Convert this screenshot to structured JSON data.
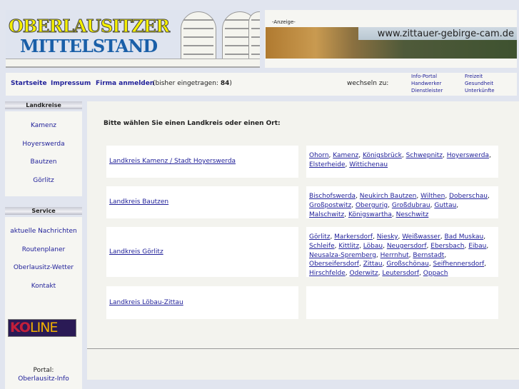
{
  "header": {
    "logo_line1": "OBERLAUSITZER",
    "logo_line2": "MITTELSTAND",
    "ad_label": "-Anzeige-",
    "ad_text": "www.zittauer-gebirge-cam.de"
  },
  "nav": {
    "items": [
      "Startseite",
      "Impressum",
      "Firma anmelden"
    ],
    "count_prefix": "(bisher eingetragen: ",
    "count": "84",
    "count_suffix": ")",
    "switch_label": "wechseln zu:",
    "switch_links": [
      "Info-Portal",
      "Handwerker",
      "Dienstleister",
      "Freizeit",
      "Gesundheit",
      "Unterkünfte"
    ]
  },
  "sidebar": {
    "landkreise_title": "Landkreise",
    "landkreise": [
      "Kamenz",
      "Hoyerswerda",
      "Bautzen",
      "Görlitz"
    ],
    "service_title": "Service",
    "service": [
      "aktuelle Nachrichten",
      "Routenplaner",
      "Oberlausitz-Wetter",
      "Kontakt"
    ],
    "banner_logo": "KOLINE",
    "portal_label": "Portal:",
    "portal_link": "Oberlausitz-Info"
  },
  "main": {
    "intro": "Bitte wählen Sie einen Landkreis oder einen Ort:",
    "rows": [
      {
        "district": "Landkreis Kamenz / Stadt Hoyerswerda",
        "places": [
          "Ohorn",
          "Kamenz",
          "Königsbrück",
          "Schwepnitz",
          "Hoyerswerda",
          "Elsterheide",
          "Wittichenau"
        ]
      },
      {
        "district": "Landkreis Bautzen",
        "places": [
          "Bischofswerda",
          "Neukirch Bautzen",
          "Wilthen",
          "Doberschau",
          "Großpostwitz",
          "Obergurig",
          "Großdubrau",
          "Guttau",
          "Malschwitz",
          "Königswartha",
          "Neschwitz"
        ]
      },
      {
        "district": "Landkreis Görlitz",
        "places": [
          "Görlitz",
          "Markersdorf",
          "Niesky",
          "Weißwasser",
          "Bad Muskau",
          "Schleife",
          "Kittlitz",
          "Löbau",
          "Neugersdorf",
          "Ebersbach",
          "Eibau",
          "Neusalza-Spremberg",
          "Herrnhut",
          "Bernstadt",
          "Oberseifersdorf",
          "Zittau",
          "Großschönau",
          "Seifhennersdorf",
          "Hirschfelde",
          "Oderwitz",
          "Leutersdorf",
          "Oppach"
        ]
      },
      {
        "district": "Landkreis Löbau-Zittau",
        "places": []
      }
    ]
  },
  "colors": {
    "link": "#22229a",
    "background": "#e1e5ef",
    "panel": "#f6f6f2"
  }
}
